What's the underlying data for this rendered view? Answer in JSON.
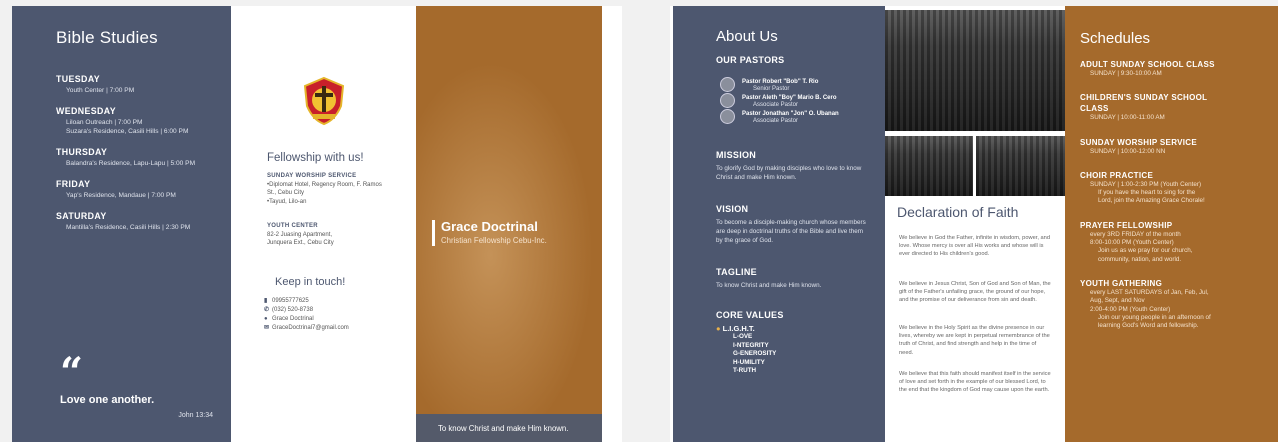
{
  "left_sheet": {
    "bible_studies": {
      "title": "Bible Studies",
      "items": [
        {
          "day": "TUESDAY",
          "lines": [
            "Youth Center | 7:00 PM"
          ]
        },
        {
          "day": "WEDNESDAY",
          "lines": [
            "Liloan Outreach | 7:00 PM",
            "Suzara's Residence, Casili Hills | 6:00 PM"
          ]
        },
        {
          "day": "THURSDAY",
          "lines": [
            "Balandra's Residence, Lapu-Lapu | 5:00 PM"
          ]
        },
        {
          "day": "FRIDAY",
          "lines": [
            "Yap's Residence, Mandaue | 7:00 PM"
          ]
        },
        {
          "day": "SATURDAY",
          "lines": [
            "Mantilla's Residence, Casili Hills | 2:30 PM"
          ]
        }
      ],
      "quote_mark": "“",
      "quote": "Love one another.",
      "quote_ref": "John 13:34"
    },
    "fellowship": {
      "title": "Fellowship with us!",
      "worship_head": "SUNDAY WORSHIP SERVICE",
      "worship_items": [
        "Diplomat Hotel, Regency Room, F. Ramos St., Cebu City",
        "Tayud, Lilo-an"
      ],
      "youth_head": "YOUTH CENTER",
      "youth_lines": [
        "82-2 Juasing Apartment,",
        "Junquera Ext., Cebu City"
      ]
    },
    "contact": {
      "title": "Keep in touch!",
      "mobile": "09955777625",
      "phone": "(032) 520-8738",
      "facebook": "Grace Doctrinal",
      "email": "GraceDoctrinal7@gmail.com"
    },
    "cover": {
      "title": "Grace Doctrinal",
      "subtitle": "Christian Fellowship Cebu-Inc.",
      "footer": "To know Christ and make Him known."
    }
  },
  "right_sheet": {
    "about": {
      "title": "About Us",
      "pastors_head": "OUR PASTORS",
      "pastors": [
        {
          "name": "Pastor Robert \"Bob\" T. Rio",
          "role": "Senior Pastor"
        },
        {
          "name": "Pastor Aleth \"Boy\" Mario B. Cero",
          "role": "Associate Pastor"
        },
        {
          "name": "Pastor Jonathan \"Jon\" O. Ubanan",
          "role": "Associate Pastor"
        }
      ],
      "mission_head": "MISSION",
      "mission": "To glorify God by making disciples who love to know Christ and make Him known.",
      "vision_head": "VISION",
      "vision": "To become a disciple-making church whose members are deep in doctrinal truths of the Bible and live them by the grace of God.",
      "tagline_head": "TAGLINE",
      "tagline": "To know Christ and make Him known.",
      "values_head": "CORE VALUES",
      "values_top": "L.I.G.H.T.",
      "values": [
        "L-OVE",
        "I-NTEGRITY",
        "G-ENEROSITY",
        "H-UMILITY",
        "T-RUTH"
      ]
    },
    "declaration": {
      "title": "Declaration of Faith",
      "paragraphs": [
        "We believe in God the Father, infinite in wisdom, power, and love. Whose mercy is over all His works and whose will is ever directed to His children's good.",
        "We believe in Jesus Christ, Son of God and Son of Man, the gift of the Father's unfailing grace, the ground of our hope, and the promise of our deliverance from sin and death.",
        "We believe in the Holy Spirit as the divine presence in our lives, whereby we are kept in perpetual remembrance of the truth of Christ, and find strength and help in the time of need.",
        "We believe that this faith should manifest itself in the service of love and set forth in the example of our blessed Lord, to the end that the kingdom of God may cause upon the earth."
      ]
    },
    "schedules": {
      "title": "Schedules",
      "items": [
        {
          "head": "ADULT SUNDAY SCHOOL CLASS",
          "lines": [
            "SUNDAY | 9:30-10:00 AM"
          ]
        },
        {
          "head": "CHILDREN'S SUNDAY SCHOOL CLASS",
          "lines": [
            "SUNDAY | 10:00-11:00 AM"
          ]
        },
        {
          "head": "SUNDAY WORSHIP SERVICE",
          "lines": [
            "SUNDAY | 10:00-12:00 NN"
          ]
        },
        {
          "head": "CHOIR PRACTICE",
          "lines": [
            "SUNDAY | 1:00-2:30 PM (Youth Center)"
          ],
          "extra": [
            "If you have the heart to sing for the",
            "Lord, join the Amazing Grace Chorale!"
          ]
        },
        {
          "head": "PRAYER FELLOWSHIP",
          "lines": [
            "every 3RD FRIDAY of the month",
            "8:00-10:00 PM (Youth Center)"
          ],
          "extra": [
            "Join us as we pray for our church,",
            "community, nation, and world."
          ]
        },
        {
          "head": "YOUTH GATHERING",
          "lines": [
            "every LAST SATURDAYS of Jan, Feb, Jul,",
            "Aug, Sept, and Nov",
            "2:00-4:00 PM (Youth Center)"
          ],
          "extra": [
            "Join our young people in an afternoon of",
            "learning God's Word and fellowship."
          ]
        }
      ]
    }
  },
  "colors": {
    "slate": "#4d576f",
    "amber": "#a56a2c"
  },
  "icons": [
    "quote-icon",
    "church-logo-icon",
    "mobile-icon",
    "phone-icon",
    "facebook-icon",
    "email-icon",
    "bulb-icon"
  ]
}
